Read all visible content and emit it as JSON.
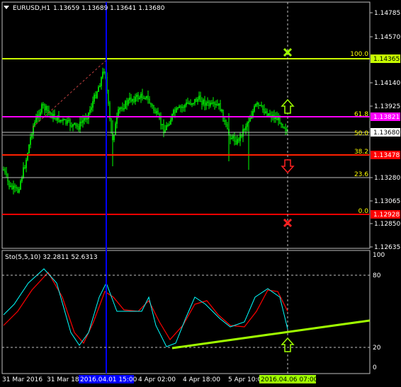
{
  "header": {
    "symbol": "EURUSD,H1",
    "ohlc": "1.13659 1.13689 1.13641 1.13680"
  },
  "price_axis": {
    "ticks": [
      "1.14785",
      "1.14570",
      "1.14140",
      "1.13925",
      "1.13710",
      "1.13495",
      "1.13280",
      "1.13065",
      "1.12850",
      "1.12635"
    ],
    "tags": [
      {
        "text": "1.14365",
        "bg": "#c8ff00",
        "fg": "#000000"
      },
      {
        "text": "1.13821",
        "bg": "#ff00ff",
        "fg": "#ffffff"
      },
      {
        "text": "1.13680",
        "bg": "#ffffff",
        "fg": "#000000"
      },
      {
        "text": "1.13478",
        "bg": "#ff0000",
        "fg": "#ffffff"
      },
      {
        "text": "1.12928",
        "bg": "#ff0000",
        "fg": "#ffffff"
      }
    ]
  },
  "fib_levels": [
    "100.0",
    "61.8",
    "50.0",
    "38.2",
    "23.6",
    "0.0"
  ],
  "indicator": {
    "label": "Sto(5,5,10) 32.2811 52.6313",
    "levels": [
      "80",
      "20"
    ],
    "scale": [
      "100",
      "0"
    ]
  },
  "time_axis": {
    "labels": [
      "31 Mar 2016",
      "31 Mar 18:00",
      "4 Apr 02:00",
      "4 Apr 18:00",
      "5 Apr 10:00"
    ],
    "highlight_left": "2016.04.01 15:00",
    "highlight_right": "2016.04.06 07:00"
  },
  "colors": {
    "background": "#000000",
    "bullish": "#00ff00",
    "fib_100": "#c8ff00",
    "fib_618": "#ff00ff",
    "fib_red": "#ff0000",
    "main_line": "#ff0000",
    "signal_line": "#00ffff",
    "trendline": "#a0ff00",
    "crosshair": "#0000ff"
  }
}
